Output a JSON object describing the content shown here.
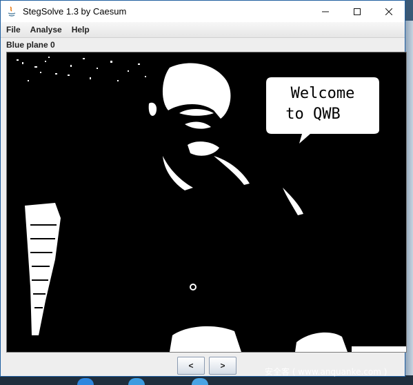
{
  "window": {
    "title": "StegSolve 1.3 by Caesum",
    "icon": "java-icon",
    "controls": [
      "minimize-icon",
      "maximize-icon",
      "close-icon"
    ]
  },
  "menu": {
    "items": [
      {
        "label": "File"
      },
      {
        "label": "Analyse"
      },
      {
        "label": "Help"
      }
    ]
  },
  "plane_label": "Blue plane 0",
  "image": {
    "bubble_line1": "Welcome",
    "bubble_line2": "to QWB"
  },
  "nav": {
    "prev_label": "<",
    "next_label": ">"
  },
  "watermark": "安全客 ( www.anquanke.com )",
  "colors": {
    "accent": "#1f5fa0",
    "image_bg": "#000000",
    "image_fg": "#ffffff"
  }
}
